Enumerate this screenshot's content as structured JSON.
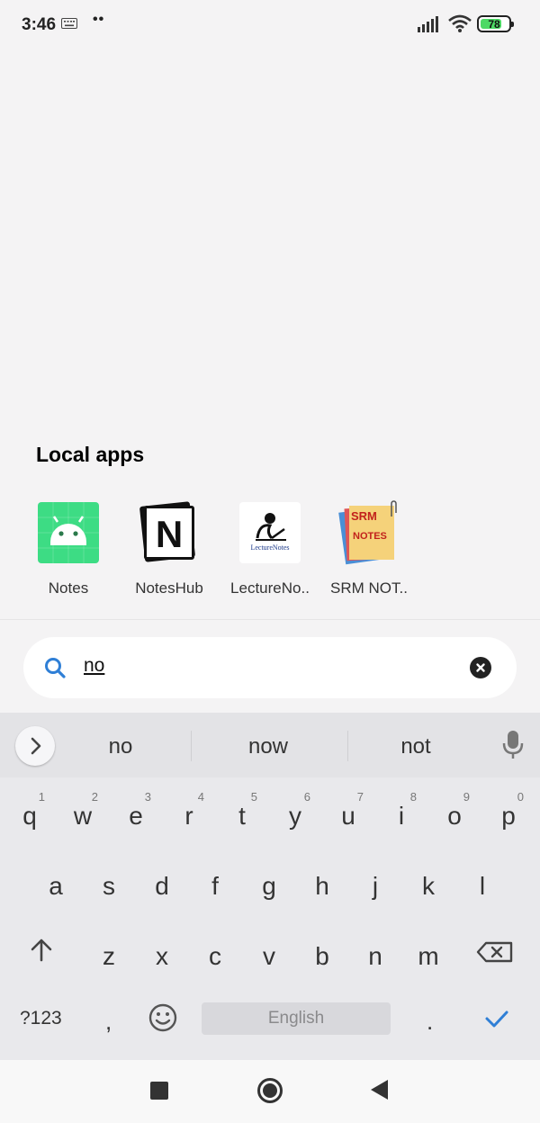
{
  "status_bar": {
    "time": "3:46",
    "notification_dots": "••",
    "battery_level": "78",
    "battery_fraction": 0.78,
    "icons": [
      "keyboard-icon",
      "signal-icon",
      "wifi-icon",
      "battery-icon"
    ]
  },
  "local_apps": {
    "title": "Local apps",
    "apps": [
      {
        "label": "Notes",
        "icon": "android-notes-icon"
      },
      {
        "label": "NotesHub",
        "icon": "noteshub-icon",
        "glyph": "N"
      },
      {
        "label": "LectureNo..",
        "icon": "lecturenotes-icon",
        "icon_text": "LectureNotes"
      },
      {
        "label": "SRM NOT..",
        "icon": "srm-notes-icon",
        "icon_text_1": "SRM",
        "icon_text_2": "NOTES"
      }
    ]
  },
  "search": {
    "query": "no",
    "icon": "search-icon",
    "clear_icon": "clear-icon"
  },
  "keyboard": {
    "suggestions": [
      "no",
      "now",
      "not"
    ],
    "row1": [
      {
        "ch": "q",
        "sup": "1"
      },
      {
        "ch": "w",
        "sup": "2"
      },
      {
        "ch": "e",
        "sup": "3"
      },
      {
        "ch": "r",
        "sup": "4"
      },
      {
        "ch": "t",
        "sup": "5"
      },
      {
        "ch": "y",
        "sup": "6"
      },
      {
        "ch": "u",
        "sup": "7"
      },
      {
        "ch": "i",
        "sup": "8"
      },
      {
        "ch": "o",
        "sup": "9"
      },
      {
        "ch": "p",
        "sup": "0"
      }
    ],
    "row2": [
      "a",
      "s",
      "d",
      "f",
      "g",
      "h",
      "j",
      "k",
      "l"
    ],
    "row3": [
      "z",
      "x",
      "c",
      "v",
      "b",
      "n",
      "m"
    ],
    "symbols_label": "?123",
    "comma_label": ",",
    "period_label": ".",
    "space_label": "English"
  },
  "colors": {
    "accent": "#2f7fd6",
    "battery_fill": "#4cd964",
    "notes_icon_bg": "#3ddc84"
  }
}
